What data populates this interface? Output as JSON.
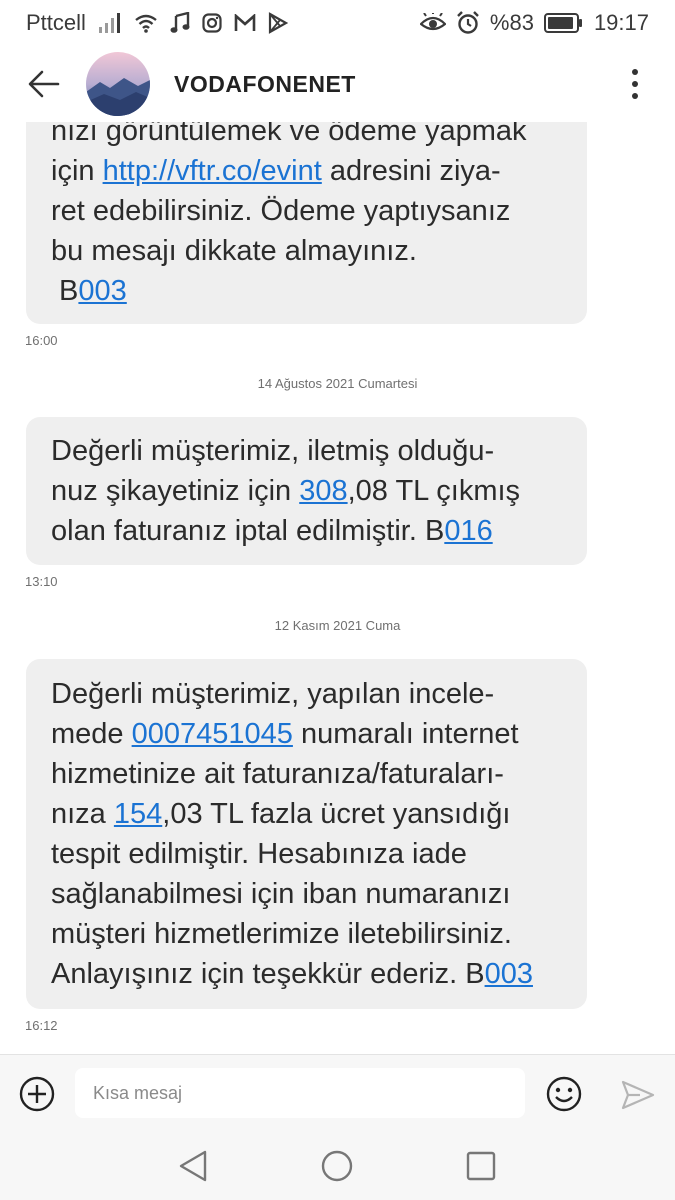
{
  "status_bar": {
    "carrier": "Pttcell",
    "battery": "%83",
    "time": "19:17"
  },
  "header": {
    "contact_name": "VODAFONENET"
  },
  "messages": [
    {
      "line1": "nızı görüntülemek ve ödeme yapmak",
      "line2_pre": "için ",
      "line2_link": "http://vftr.co/evint",
      "line2_post": " adresini ziya-",
      "line3": "ret edebilirsiniz. Ödeme yaptıysanız",
      "line4": "bu mesajı dikkate almayınız.",
      "line5_pre": " B",
      "line5_link": "003",
      "time": "16:00"
    },
    {
      "date_separator": "14 Ağustos 2021 Cumartesi",
      "line1": "Değerli müşterimiz, iletmiş olduğu-",
      "line2_pre": "nuz şikayetiniz için ",
      "line2_link": "308",
      "line2_post": ",08 TL çıkmış",
      "line3_pre": "olan faturanız iptal edilmiştir. B",
      "line3_link": "016",
      "time": "13:10"
    },
    {
      "date_separator": "12 Kasım 2021 Cuma",
      "line1": "Değerli müşterimiz, yapılan incele-",
      "line2_pre": "mede ",
      "line2_link": "0007451045",
      "line2_post": " numaralı internet",
      "line3": "hizmetinize ait faturanıza/faturaları-",
      "line4_pre": "nıza ",
      "line4_link": "154",
      "line4_post": ",03 TL fazla ücret yansıdığı",
      "line5": "tespit edilmiştir. Hesabınıza iade",
      "line6": "sağlanabilmesi için iban numaranızı",
      "line7": "müşteri hizmetlerimize iletebilirsiniz.",
      "line8_pre": "Anlayışınız için teşekkür ederiz. B",
      "line8_link": "003",
      "time": "16:12"
    }
  ],
  "composer": {
    "placeholder": "Kısa mesaj"
  },
  "colors": {
    "link": "#1b73d3",
    "bubble": "#efefef",
    "background": "#ffffff"
  }
}
